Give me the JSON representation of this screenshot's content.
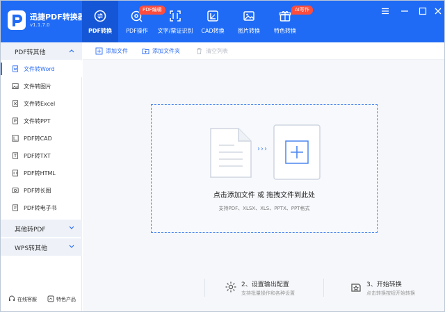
{
  "app": {
    "name": "迅捷PDF转换器",
    "version": "v1.1.7.0"
  },
  "nav": [
    {
      "label": "PDF转换",
      "icon": "convert-icon",
      "active": true
    },
    {
      "label": "PDF操作",
      "icon": "pdf-edit-icon",
      "badge": "PDF编辑"
    },
    {
      "label": "文字/票证识别",
      "icon": "ocr-scan-icon"
    },
    {
      "label": "CAD转换",
      "icon": "cad-icon"
    },
    {
      "label": "图片转换",
      "icon": "image-icon"
    },
    {
      "label": "特色转换",
      "icon": "gift-icon",
      "badge": "AI写作"
    }
  ],
  "sidebar": {
    "cat_pdf_to_other": "PDF转其他",
    "items": [
      {
        "label": "文件转Word",
        "icon": "word-icon"
      },
      {
        "label": "文件转图片",
        "icon": "image-file-icon"
      },
      {
        "label": "文件转Excel",
        "icon": "excel-icon"
      },
      {
        "label": "文件转PPT",
        "icon": "ppt-icon"
      },
      {
        "label": "PDF转CAD",
        "icon": "cad-file-icon"
      },
      {
        "label": "PDF转TXT",
        "icon": "txt-icon"
      },
      {
        "label": "PDF转HTML",
        "icon": "html-icon"
      },
      {
        "label": "PDF转长图",
        "icon": "long-image-icon"
      },
      {
        "label": "PDF转电子书",
        "icon": "ebook-icon"
      }
    ],
    "cat_other_to_pdf": "其他转PDF",
    "cat_wps_to_other": "WPS转其他",
    "footer_service": "在线客服",
    "footer_products": "特色产品"
  },
  "toolbar": {
    "add_file": "添加文件",
    "add_folder": "添加文件夹",
    "clear_list": "清空列表"
  },
  "dropzone": {
    "title": "点击添加文件 或 拖拽文件到此处",
    "subtitle": "支持PDF、XLSX、XLS、PPTX、PPT格式",
    "arrows": "›››"
  },
  "steps": [
    {
      "title": "2、设置输出配置",
      "sub": "支持批量操作和各种设置"
    },
    {
      "title": "3、开始转换",
      "sub": "点击转换按钮开始转换"
    }
  ],
  "colors": {
    "brand": "#1f6bf5",
    "active_nav": "#1556d6",
    "accent": "#2f6ef5",
    "badge": "#ff4d3d"
  }
}
